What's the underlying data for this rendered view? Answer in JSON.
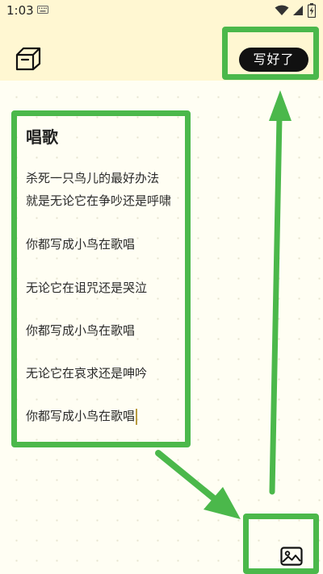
{
  "status": {
    "time": "1:03"
  },
  "header": {
    "done_label": "写好了"
  },
  "note": {
    "title": "唱歌",
    "lines": [
      "杀死一只鸟儿的最好办法",
      "就是无论它在争吵还是呼啸",
      "你都写成小鸟在歌唱",
      "无论它在诅咒还是哭泣",
      "你都写成小鸟在歌唱",
      "无论它在哀求还是呻吟",
      "你都写成小鸟在歌唱"
    ]
  },
  "colors": {
    "header_bg": "#fff7d2",
    "page_bg": "#fffef3",
    "highlight": "#4bb84b",
    "button_bg": "#111111"
  },
  "icons": [
    "keyboard-icon",
    "wifi-icon",
    "signal-icon",
    "battery-icon",
    "box-icon",
    "image-icon"
  ]
}
